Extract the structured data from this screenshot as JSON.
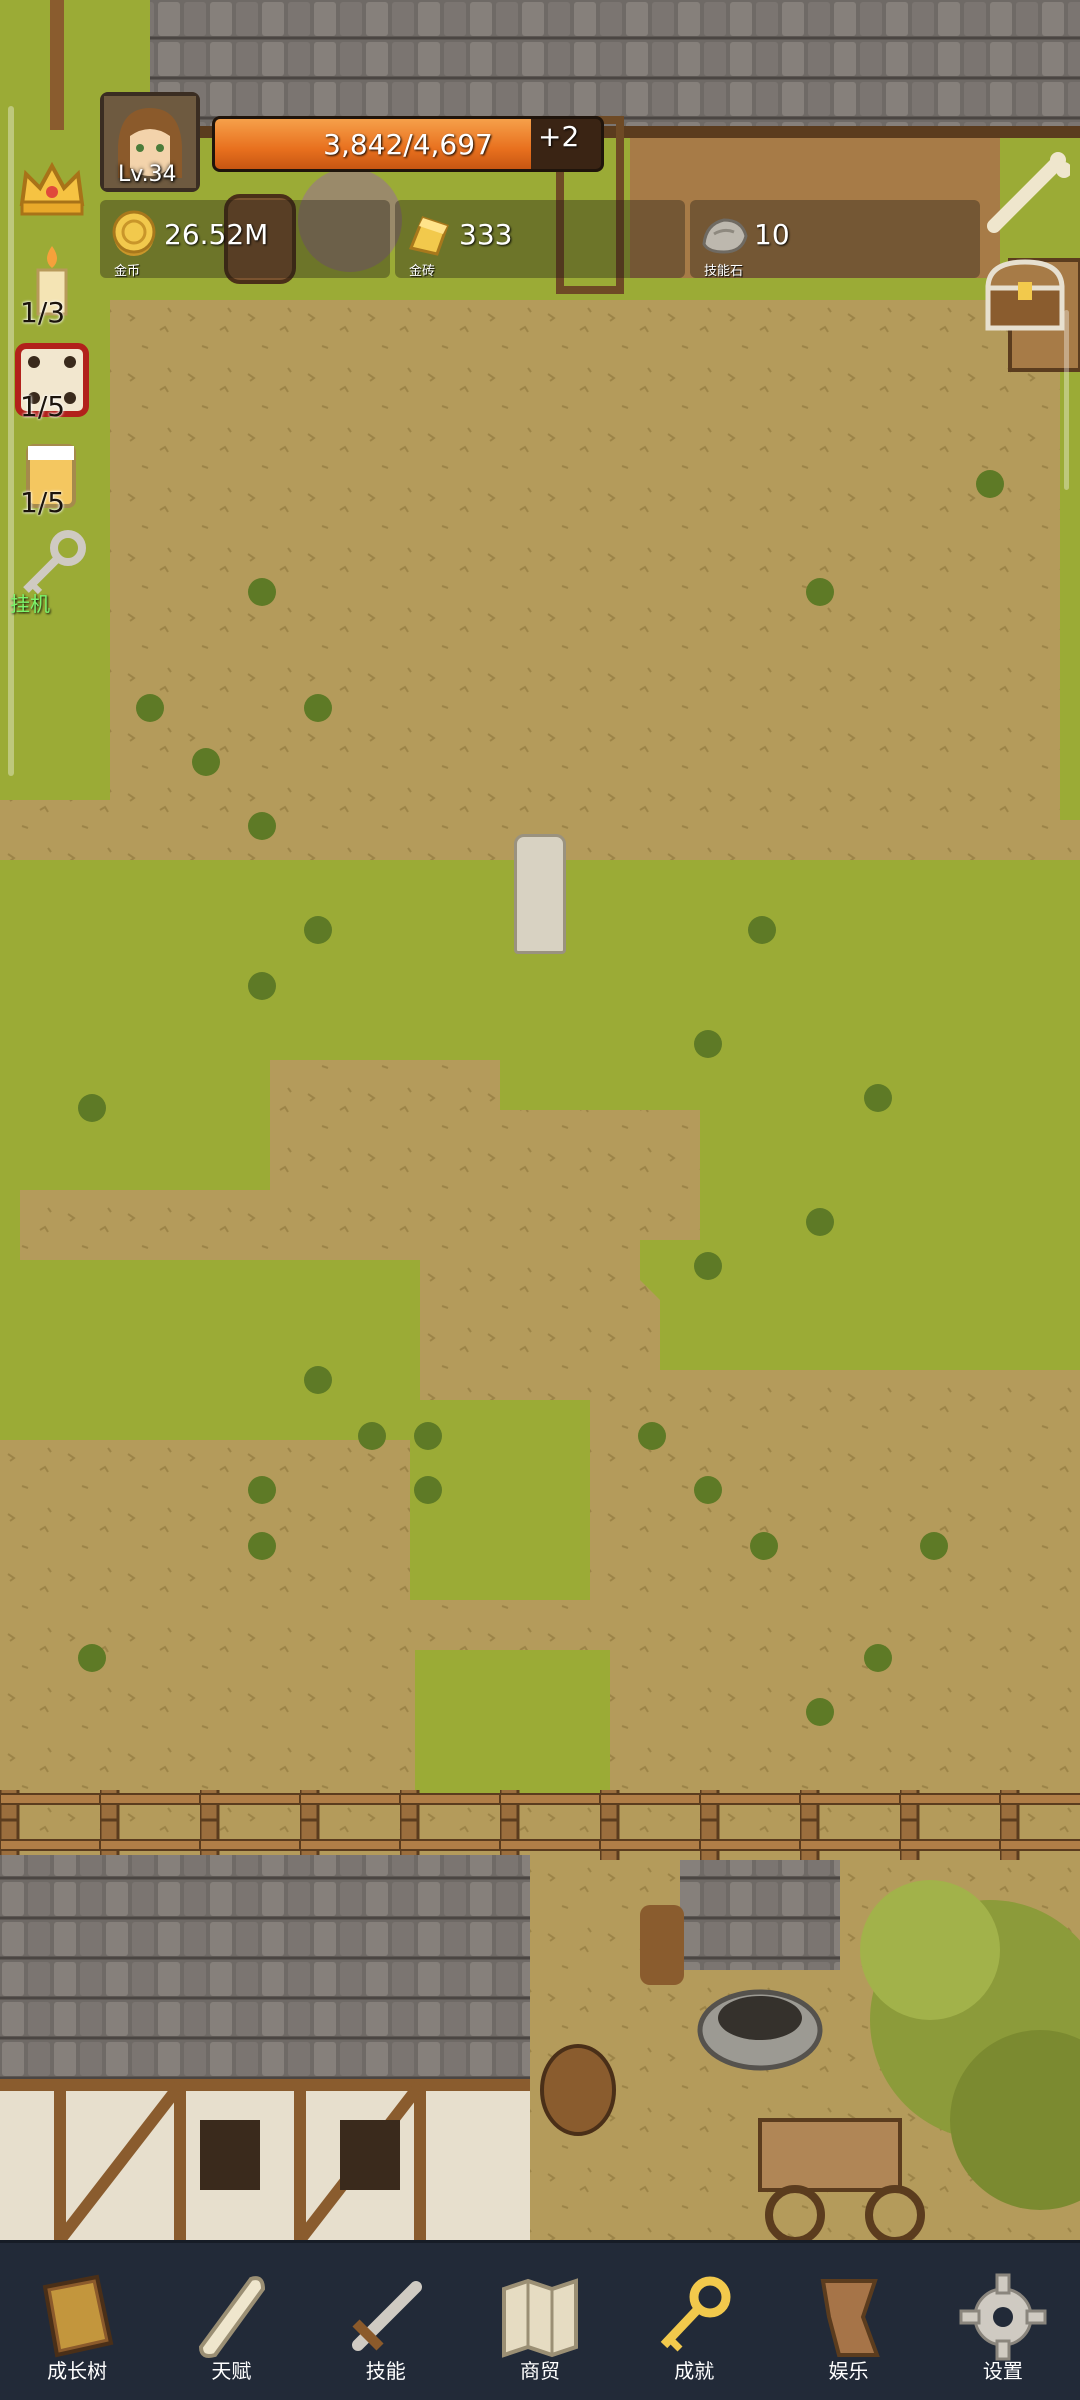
{
  "hud": {
    "level": "Lv.34",
    "exp_text": "3,842/4,697",
    "exp_fraction": 0.818,
    "exp_bonus": "+2",
    "currencies": [
      {
        "icon": "gold-coin-icon",
        "value": "26.52M",
        "label": "金币"
      },
      {
        "icon": "gold-brick-icon",
        "value": "333",
        "label": "金砖"
      },
      {
        "icon": "skill-stone-icon",
        "value": "10",
        "label": "技能石"
      }
    ]
  },
  "side_buttons": [
    {
      "name": "crown-icon"
    },
    {
      "name": "candle-icon",
      "count": "1/3"
    },
    {
      "name": "dice-icon",
      "count": "1/5"
    },
    {
      "name": "beer-mug-icon",
      "count": "1/5"
    },
    {
      "name": "key-idle-icon",
      "label": "挂机"
    }
  ],
  "right_buttons": [
    {
      "name": "bone-icon"
    },
    {
      "name": "treasure-chest-icon"
    }
  ],
  "nav": {
    "items": [
      {
        "icon": "book-icon",
        "label": "成长树"
      },
      {
        "icon": "scroll-icon",
        "label": "天赋"
      },
      {
        "icon": "sword-icon",
        "label": "技能"
      },
      {
        "icon": "map-icon",
        "label": "商贸"
      },
      {
        "icon": "golden-key-icon",
        "label": "成就"
      },
      {
        "icon": "ribbon-icon",
        "label": "娱乐"
      },
      {
        "icon": "gear-icon",
        "label": "设置"
      }
    ]
  },
  "colors": {
    "dirt": "#b39a5a",
    "grass": "#9bab36",
    "exp_orange": "#e8701e",
    "nav_bg": "#222a38"
  }
}
